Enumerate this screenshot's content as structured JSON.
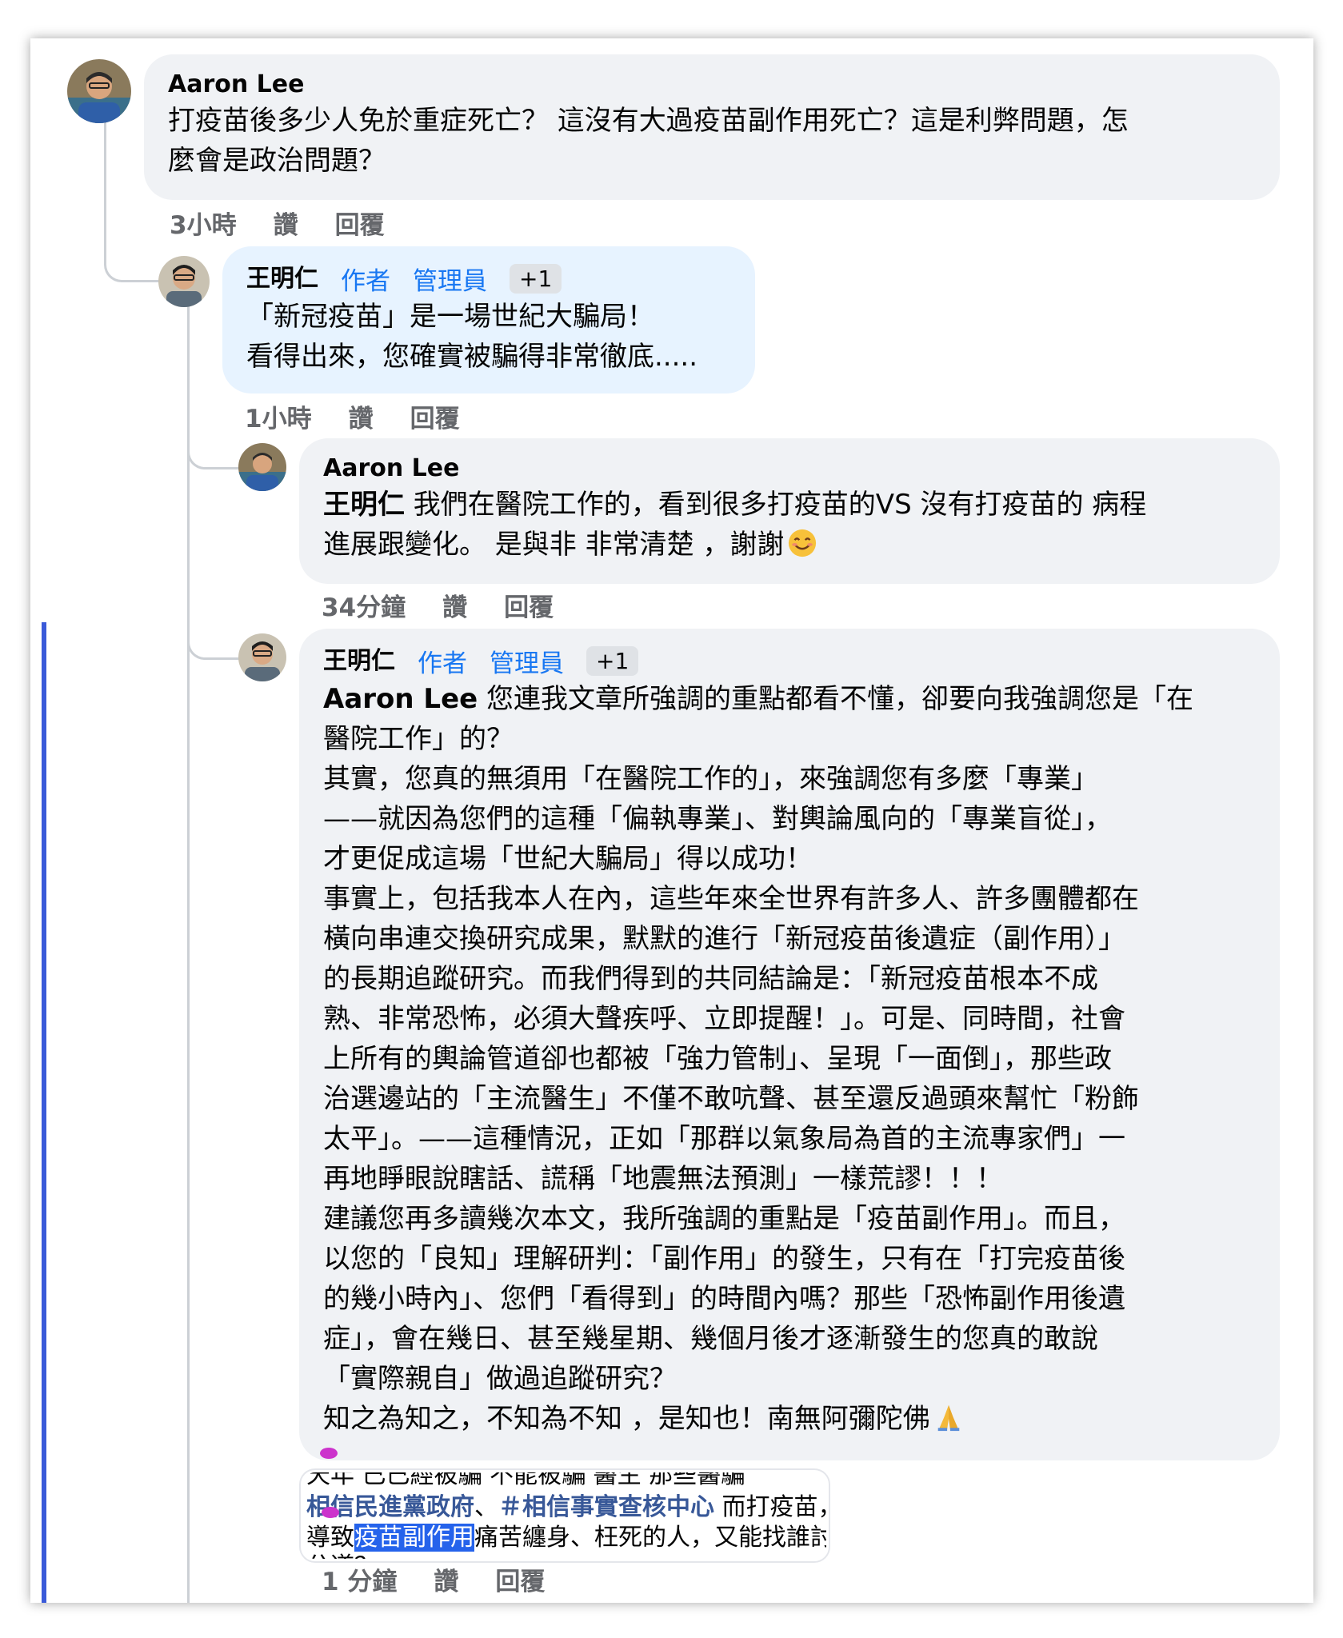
{
  "comments": [
    {
      "author": "Aaron Lee",
      "lines": [
        "打疫苗後多少人免於重症死亡？ 這沒有大過疫苗副作用死亡？這是利弊問題，怎",
        "麼會是政治問題？"
      ],
      "time": "3小時",
      "like": "讚",
      "reply": "回覆"
    },
    {
      "author": "王明仁",
      "badge_author": "作者",
      "badge_admin": "管理員",
      "badge_more": "+1",
      "lines": [
        "「新冠疫苗」是一場世紀大騙局！",
        "看得出來，您確實被騙得非常徹底....."
      ],
      "time": "1小時",
      "like": "讚",
      "reply": "回覆"
    },
    {
      "author": "Aaron Lee",
      "mention": "王明仁",
      "first_line_rest": " 我們在醫院工作的，看到很多打疫苗的VS 沒有打疫苗的 病程",
      "lines": [
        "進展跟變化。 是與非 非常清楚 ，謝謝"
      ],
      "emoji": "smiling-face",
      "time": "34分鐘",
      "like": "讚",
      "reply": "回覆"
    },
    {
      "author": "王明仁",
      "badge_author": "作者",
      "badge_admin": "管理員",
      "badge_more": "+1",
      "mention": "Aaron Lee",
      "first_line_rest": " 您連我文章所強調的重點都看不懂，卻要向我強調您是「在",
      "lines": [
        "醫院工作」的？",
        "其實，您真的無須用「在醫院工作的」，來強調您有多麼「專業」",
        "——就因為您們的這種「偏執專業」、對輿論風向的「專業盲從」，",
        "才更促成這場「世紀大騙局」得以成功！",
        "事實上，包括我本人在內，這些年來全世界有許多人、許多團體都在",
        "橫向串連交換研究成果，默默的進行「新冠疫苗後遺症（副作用）」",
        "的長期追蹤研究。而我們得到的共同結論是：「新冠疫苗根本不成",
        "熟、非常恐怖，必須大聲疾呼、立即提醒！」。可是、同時間，社會",
        "上所有的輿論管道卻也都被「強力管制」、呈現「一面倒」，那些政",
        "治選邊站的「主流醫生」不僅不敢吭聲、甚至還反過頭來幫忙「粉飾",
        "太平」。——這種情況，正如「那群以氣象局為首的主流專家們」一",
        "再地睜眼說瞎話、謊稱「地震無法預測」一樣荒謬！！！",
        "建議您再多讀幾次本文，我所強調的重點是「疫苗副作用」。而且，",
        "以您的「良知」理解研判：「副作用」的發生，只有在「打完疫苗後",
        "的幾小時內」、您們「看得到」的時間內嗎？那些「恐怖副作用後遺",
        "症」，會在幾日、甚至幾星期、幾個月後才逐漸發生的您真的敢說",
        "「實際親自」做過追蹤研究？"
      ],
      "last_line": "知之為知之，不知為不知 ，是知也！南無阿彌陀佛",
      "emoji": "folded-hands",
      "time": "1 分鐘",
      "like": "讚",
      "reply": "回覆"
    }
  ],
  "snippet": {
    "cut_top": "天年  已已經被騙  不能被騙  醫生  那些醫騙",
    "tag1": "相信民進黨政府",
    "sep": "、",
    "tag2": "＃相信事實查核中心",
    "after_tags": " 而打疫苗，",
    "line2_before": "導致",
    "line2_selected": "疫苗副作用",
    "line2_after": "痛苦纏身、枉死的人，又能找誰討",
    "cut_bottom": "公道？"
  },
  "colors": {
    "bubble": "#f0f2f5",
    "bubble_highlight": "#e7f3ff",
    "badge_blue": "#1877f2",
    "action_gray": "#65676b",
    "thread_line": "#ccd0d5",
    "left_bar": "#3a5ad9",
    "selection": "#2563eb",
    "hashtag": "#385898"
  }
}
